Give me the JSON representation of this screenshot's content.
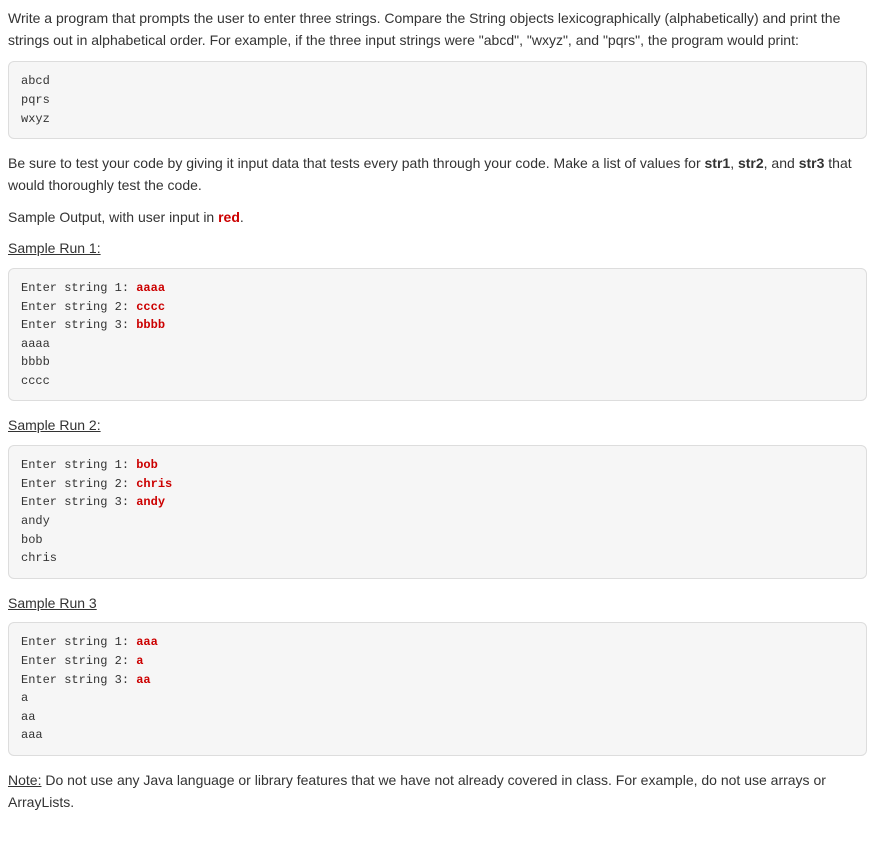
{
  "intro": {
    "part1": "Write a program that prompts the user to enter three strings. Compare the String objects lexicographically (alphabetically) and print the strings out in alphabetical order. For example, if the three input strings were \"abcd\", \"wxyz\", and \"pqrs\", the program would print:"
  },
  "example_output": "abcd\npqrs\nwxyz",
  "test_note": {
    "part1": "Be sure to test your code by giving it input data that tests every path through your code. Make a list of values for ",
    "str1": "str1",
    "comma1": ", ",
    "str2": "str2",
    "comma2": ", and ",
    "str3": "str3",
    "part2": " that would thoroughly test the code."
  },
  "sample_output_label": {
    "prefix": "Sample Output, with user input in ",
    "red": "red",
    "suffix": "."
  },
  "run1": {
    "title": "Sample Run 1: ",
    "l1p": "Enter string 1: ",
    "l1i": "aaaa",
    "l2p": "Enter string 2: ",
    "l2i": "cccc",
    "l3p": "Enter string 3: ",
    "l3i": "bbbb",
    "o1": "aaaa",
    "o2": "bbbb",
    "o3": "cccc"
  },
  "run2": {
    "title": "Sample Run 2:",
    "l1p": "Enter string 1: ",
    "l1i": "bob",
    "l2p": "Enter string 2: ",
    "l2i": "chris",
    "l3p": "Enter string 3: ",
    "l3i": "andy",
    "o1": "andy",
    "o2": "bob",
    "o3": "chris"
  },
  "run3": {
    "title": "Sample  Run 3",
    "l1p": "Enter string 1: ",
    "l1i": "aaa",
    "l2p": "Enter string 2: ",
    "l2i": "a",
    "l3p": "Enter string 3: ",
    "l3i": "aa",
    "o1": "a",
    "o2": "aa",
    "o3": "aaa"
  },
  "note": {
    "label": "Note:",
    "text": " Do not use any Java language or library features that we have not already covered in class. For example, do not use arrays or ArrayLists."
  }
}
